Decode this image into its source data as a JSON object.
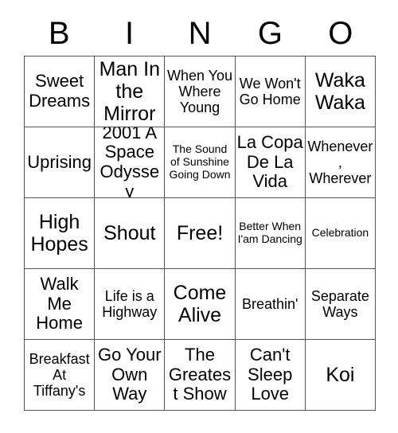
{
  "card": {
    "header": {
      "letters": [
        "B",
        "I",
        "N",
        "G",
        "O"
      ]
    },
    "rows": [
      [
        {
          "text": "Sweet Dreams",
          "size": "fs-lg"
        },
        {
          "text": "Man In the Mirror",
          "size": "fs-xl"
        },
        {
          "text": "When You Where Young",
          "size": "fs-md"
        },
        {
          "text": "We Won't Go Home",
          "size": "fs-md"
        },
        {
          "text": "Waka Waka",
          "size": "fs-xl"
        }
      ],
      [
        {
          "text": "Uprising",
          "size": "fs-lg"
        },
        {
          "text": "2001 A Space Odyssey",
          "size": "fs-lg"
        },
        {
          "text": "The Sound of Sunshine Going Down",
          "size": "fs-sm"
        },
        {
          "text": "La Copa De La Vida",
          "size": "fs-lg"
        },
        {
          "text": "Whenever, Wherever",
          "size": "fs-md"
        }
      ],
      [
        {
          "text": "High Hopes",
          "size": "fs-xl"
        },
        {
          "text": "Shout",
          "size": "fs-xl"
        },
        {
          "text": "Free!",
          "size": "fs-xl"
        },
        {
          "text": "Better When I'am Dancing",
          "size": "fs-sm"
        },
        {
          "text": "Celebration",
          "size": "fs-sm"
        }
      ],
      [
        {
          "text": "Walk Me Home",
          "size": "fs-lg"
        },
        {
          "text": "Life is a Highway",
          "size": "fs-md"
        },
        {
          "text": "Come Alive",
          "size": "fs-xl"
        },
        {
          "text": "Breathin'",
          "size": "fs-md"
        },
        {
          "text": "Separate Ways",
          "size": "fs-md"
        }
      ],
      [
        {
          "text": "Breakfast At Tiffany's",
          "size": "fs-md"
        },
        {
          "text": "Go Your Own Way",
          "size": "fs-lg"
        },
        {
          "text": "The Greatest Show",
          "size": "fs-lg"
        },
        {
          "text": "Can't Sleep Love",
          "size": "fs-lg"
        },
        {
          "text": "Koi",
          "size": "fs-xl"
        }
      ]
    ]
  }
}
